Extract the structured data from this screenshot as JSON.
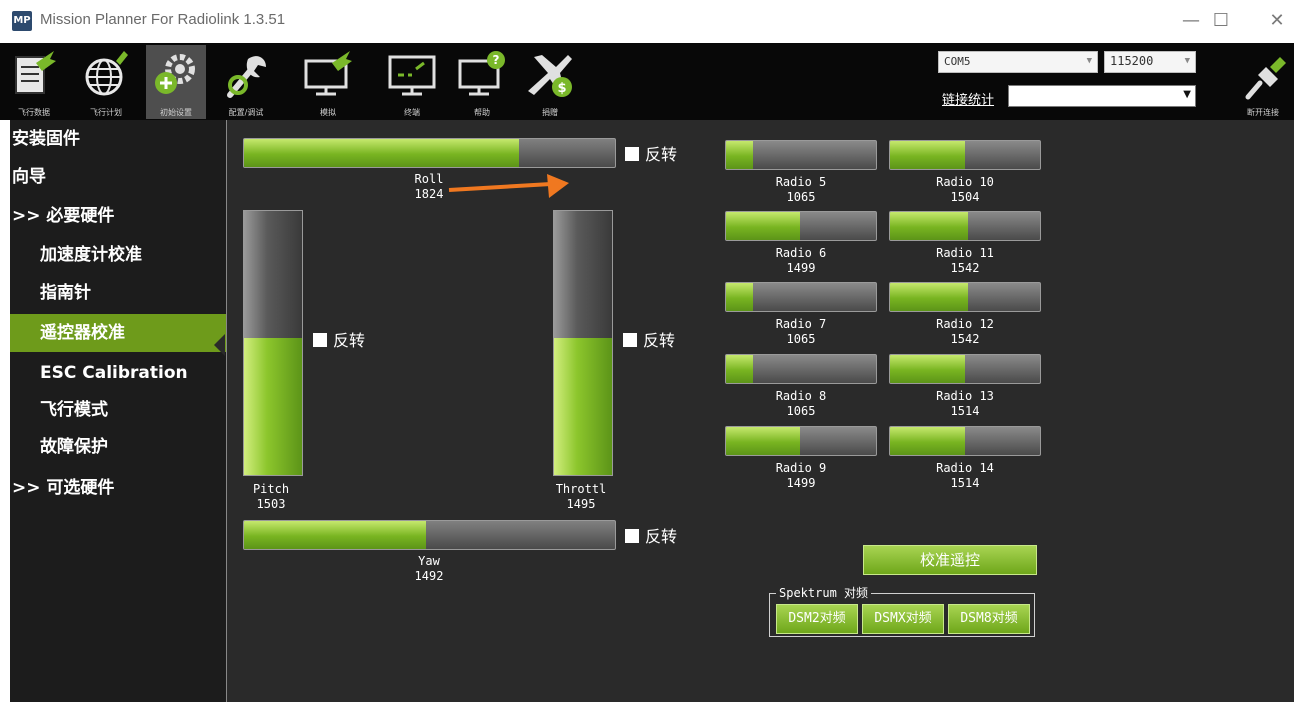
{
  "window": {
    "title": "Mission Planner For Radiolink 1.3.51",
    "logo_text": "MP",
    "minimize": "—",
    "maximize": "☐",
    "close": "✕"
  },
  "toolbar": {
    "items": [
      {
        "label": "飞行数据",
        "icon": "flight-data-icon"
      },
      {
        "label": "飞行计划",
        "icon": "flight-plan-icon"
      },
      {
        "label": "初始设置",
        "icon": "initial-setup-icon"
      },
      {
        "label": "配置/调试",
        "icon": "config-tuning-icon"
      },
      {
        "label": "模拟",
        "icon": "simulation-icon"
      },
      {
        "label": "终端",
        "icon": "terminal-icon"
      },
      {
        "label": "帮助",
        "icon": "help-icon"
      },
      {
        "label": "捐赠",
        "icon": "donate-icon"
      }
    ],
    "com_port": "COM5",
    "baud_rate": "115200",
    "link_stats_label": "链接统计",
    "link_select_value": "",
    "disconnect_label": "断开连接"
  },
  "sidebar": {
    "items": [
      {
        "label": "安装固件"
      },
      {
        "label": "向导"
      },
      {
        "label": ">> 必要硬件"
      },
      {
        "label": "加速度计校准"
      },
      {
        "label": "指南针"
      },
      {
        "label": "遥控器校准"
      },
      {
        "label": "ESC Calibration"
      },
      {
        "label": "飞行模式"
      },
      {
        "label": "故障保护"
      },
      {
        "label": ">> 可选硬件"
      }
    ],
    "active_index": 5
  },
  "radio": {
    "reverse_label": "反转",
    "roll": {
      "name": "Roll",
      "value": "1824",
      "fill": 0.74
    },
    "pitch": {
      "name": "Pitch",
      "value": "1503",
      "fill": 0.52
    },
    "throttle": {
      "name": "Throttl",
      "value": "1495",
      "fill": 0.52
    },
    "yaw": {
      "name": "Yaw",
      "value": "1492",
      "fill": 0.49
    },
    "channels": [
      {
        "name": "Radio 5",
        "value": "1065",
        "fill": 0.18
      },
      {
        "name": "Radio 10",
        "value": "1504",
        "fill": 0.5
      },
      {
        "name": "Radio 6",
        "value": "1499",
        "fill": 0.49
      },
      {
        "name": "Radio 11",
        "value": "1542",
        "fill": 0.52
      },
      {
        "name": "Radio 7",
        "value": "1065",
        "fill": 0.18
      },
      {
        "name": "Radio 12",
        "value": "1542",
        "fill": 0.52
      },
      {
        "name": "Radio 8",
        "value": "1065",
        "fill": 0.18
      },
      {
        "name": "Radio 13",
        "value": "1514",
        "fill": 0.5
      },
      {
        "name": "Radio 9",
        "value": "1499",
        "fill": 0.49
      },
      {
        "name": "Radio 14",
        "value": "1514",
        "fill": 0.5
      }
    ],
    "calibrate_button": "校准遥控",
    "spektrum": {
      "legend": "Spektrum 对频",
      "buttons": [
        "DSM2对频",
        "DSMX对频",
        "DSM8对频"
      ]
    }
  },
  "colors": {
    "accent_green": "#6e9b1b",
    "bar_fill": "#78b421",
    "annotation_arrow": "#f07820"
  }
}
